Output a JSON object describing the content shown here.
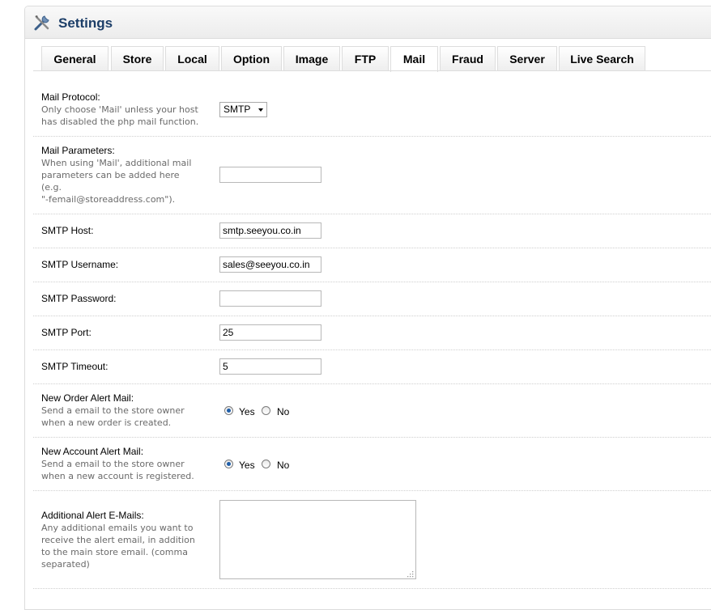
{
  "heading": {
    "title": "Settings",
    "icon": "tools-icon"
  },
  "tabs": [
    "General",
    "Store",
    "Local",
    "Option",
    "Image",
    "FTP",
    "Mail",
    "Fraud",
    "Server",
    "Live Search"
  ],
  "active_tab": "Mail",
  "fields": {
    "mail_protocol": {
      "label": "Mail Protocol:",
      "help": "Only choose 'Mail' unless your host has disabled the php mail function.",
      "value": "SMTP"
    },
    "mail_parameters": {
      "label": "Mail Parameters:",
      "help_lines": [
        "When using 'Mail', additional mail",
        "parameters can be added here",
        "(e.g.",
        "\"-femail@storeaddress.com\")."
      ],
      "value": ""
    },
    "smtp_host": {
      "label": "SMTP Host:",
      "value": "smtp.seeyou.co.in"
    },
    "smtp_username": {
      "label": "SMTP Username:",
      "value": "sales@seeyou.co.in"
    },
    "smtp_password": {
      "label": "SMTP Password:",
      "value": ""
    },
    "smtp_port": {
      "label": "SMTP Port:",
      "value": "25"
    },
    "smtp_timeout": {
      "label": "SMTP Timeout:",
      "value": "5"
    },
    "order_alert": {
      "label": "New Order Alert Mail:",
      "help_lines": [
        "Send a email to the store owner",
        "when a new order is created."
      ],
      "yes": "Yes",
      "no": "No",
      "selected": "Yes"
    },
    "account_alert": {
      "label": "New Account Alert Mail:",
      "help_lines": [
        "Send a email to the store owner",
        "when a new account is registered."
      ],
      "yes": "Yes",
      "no": "No",
      "selected": "Yes"
    },
    "alert_emails": {
      "label": "Additional Alert E-Mails:",
      "help_lines": [
        "Any additional emails you want to",
        "receive the alert email, in addition",
        "to the main store email. (comma",
        "separated)"
      ],
      "value": ""
    }
  },
  "colors": {
    "heading_text": "#1c3e68",
    "help_text": "#6a6a6a",
    "radio_dot": "#1f5ea8"
  }
}
